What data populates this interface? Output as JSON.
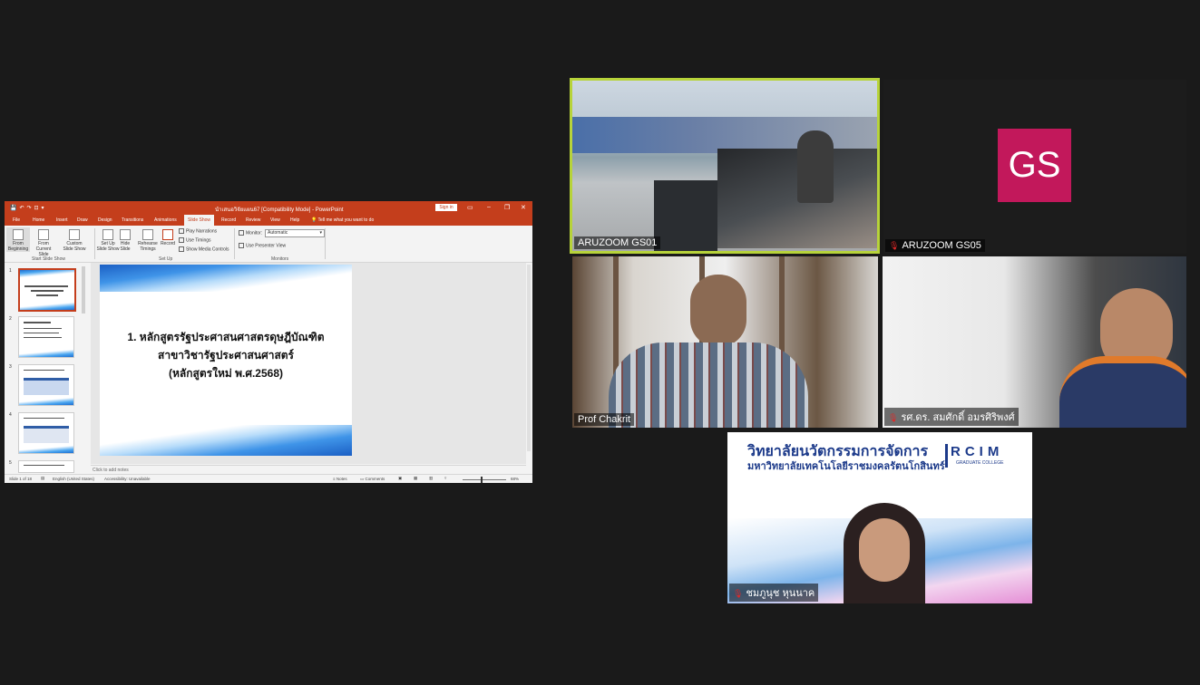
{
  "ppt": {
    "window_title": "นำเสนอวิจัยแผน67 [Compatibility Mode] - PowerPoint",
    "sign_in": "Sign in",
    "tabs": [
      "File",
      "Home",
      "Insert",
      "Draw",
      "Design",
      "Transitions",
      "Animations",
      "Slide Show",
      "Record",
      "Review",
      "View",
      "Help",
      "Tell me what you want to do"
    ],
    "active_tab": "Slide Show",
    "ribbon": {
      "from_beginning": "From Beginning",
      "from_current": "From Current Slide",
      "custom_show": "Custom Slide Show",
      "group_start": "Start Slide Show",
      "set_up": "Set Up Slide Show",
      "hide_slide": "Hide Slide",
      "rehearse": "Rehearse Timings",
      "record": "Record",
      "play_narrations": "Play Narrations",
      "use_timings": "Use Timings",
      "show_media": "Show Media Controls",
      "group_setup": "Set Up",
      "monitor_label": "Monitor:",
      "monitor_value": "Automatic",
      "presenter_view": "Use Presenter View",
      "group_monitors": "Monitors"
    },
    "slide_numbers": [
      "1",
      "2",
      "3",
      "4",
      "5"
    ],
    "slide_lines": [
      "1. หลักสูตรรัฐประศาสนศาสตรดุษฎีบัณฑิต",
      "สาขาวิชารัฐประศาสนศาสตร์",
      "(หลักสูตรใหม่ พ.ศ.2568)"
    ],
    "notes_placeholder": "Click to add notes",
    "status": {
      "slide_of": "Slide 1 of 18",
      "language": "English (United States)",
      "accessibility": "Accessibility: Unavailable",
      "notes": "Notes",
      "comments": "Comments",
      "zoom": "68%"
    }
  },
  "tiles": {
    "gs01": "ARUZOOM GS01",
    "gs05": "ARUZOOM GS05",
    "gs05_avatar": "GS",
    "chakrit": "Prof Chakrit",
    "somsak": "รศ.ดร. สมศักดิ์ อมรศิริพงศ์",
    "chompoonuch": "ชมภูนุช หุนนาค"
  },
  "rcim": {
    "thai_line1": "วิทยาลัยนวัตกรรมการจัดการ",
    "thai_line2": "มหาวิทยาลัยเทคโนโลยีราชมงคลรัตนโกสินทร์",
    "logo": "RCIM",
    "sub": "GRADUATE COLLEGE"
  },
  "colors": {
    "ppt_accent": "#c43e1c",
    "active_speaker": "#b7d33a",
    "avatar_bg": "#c2185b",
    "mic_muted": "#e02828"
  }
}
